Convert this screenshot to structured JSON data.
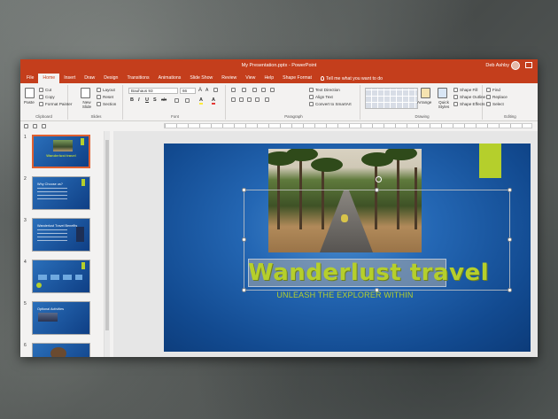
{
  "window": {
    "title": "My Presentation.pptx  -  PowerPoint",
    "user": "Deb Ashby"
  },
  "tabs": [
    "File",
    "Home",
    "Insert",
    "Draw",
    "Design",
    "Transitions",
    "Animations",
    "Slide Show",
    "Review",
    "View",
    "Help",
    "Shape Format"
  ],
  "tell_me": "Tell me what you want to do",
  "ribbon": {
    "clipboard": {
      "paste": "Paste",
      "cut": "Cut",
      "copy": "Copy",
      "format_painter": "Format Painter",
      "label": "Clipboard"
    },
    "slides": {
      "new_slide": "New Slide",
      "layout": "Layout",
      "reset": "Reset",
      "section": "Section",
      "label": "Slides"
    },
    "font": {
      "font_name": "Bauhaus 93",
      "font_size": "66",
      "label": "Font"
    },
    "paragraph": {
      "text_direction": "Text Direction",
      "align_text": "Align Text",
      "convert_smartart": "Convert to SmartArt",
      "label": "Paragraph"
    },
    "drawing": {
      "arrange": "Arrange",
      "quick_styles": "Quick Styles",
      "shape_fill": "Shape Fill",
      "shape_outline": "Shape Outline",
      "shape_effects": "Shape Effects",
      "label": "Drawing"
    },
    "editing": {
      "find": "Find",
      "replace": "Replace",
      "select": "Select",
      "label": "Editing"
    }
  },
  "thumbnails": [
    {
      "number": "1",
      "title": "Wanderlust travel"
    },
    {
      "number": "2",
      "title": "Why Choose us?"
    },
    {
      "number": "3",
      "title": "Wanderlust Travel Benefits"
    },
    {
      "number": "4",
      "title": ""
    },
    {
      "number": "5",
      "title": "Optional Activities"
    },
    {
      "number": "6",
      "title": ""
    }
  ],
  "slide": {
    "title": "Wanderlust travel",
    "subtitle": "UNLEASH THE EXPLORER WITHIN"
  },
  "colors": {
    "accent": "#c43e1c",
    "lime": "#b5cf2c",
    "slide_blue": "#2467b4"
  }
}
